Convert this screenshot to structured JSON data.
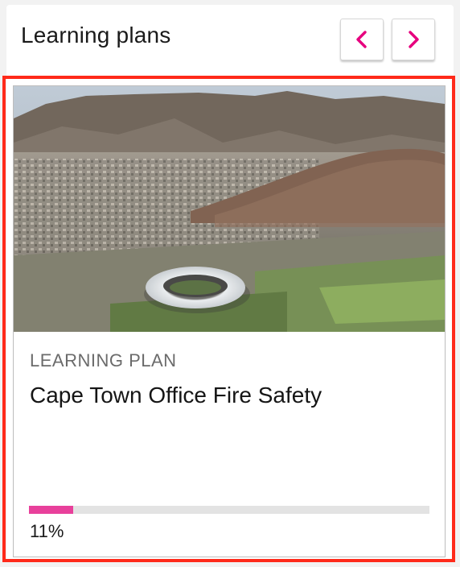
{
  "widget": {
    "title": "Learning plans",
    "prev_icon": "chevron-left-icon",
    "next_icon": "chevron-right-icon"
  },
  "card": {
    "type_label": "LEARNING PLAN",
    "title": "Cape Town Office Fire Safety",
    "image_alt": "Aerial view of Cape Town with stadium and Table Mountain",
    "progress_fraction": 0.11,
    "progress_label": "11%"
  },
  "colors": {
    "accent": "#e8409b",
    "selection_outline": "#ff2a1a",
    "progress_track": "#e3e3e3"
  }
}
